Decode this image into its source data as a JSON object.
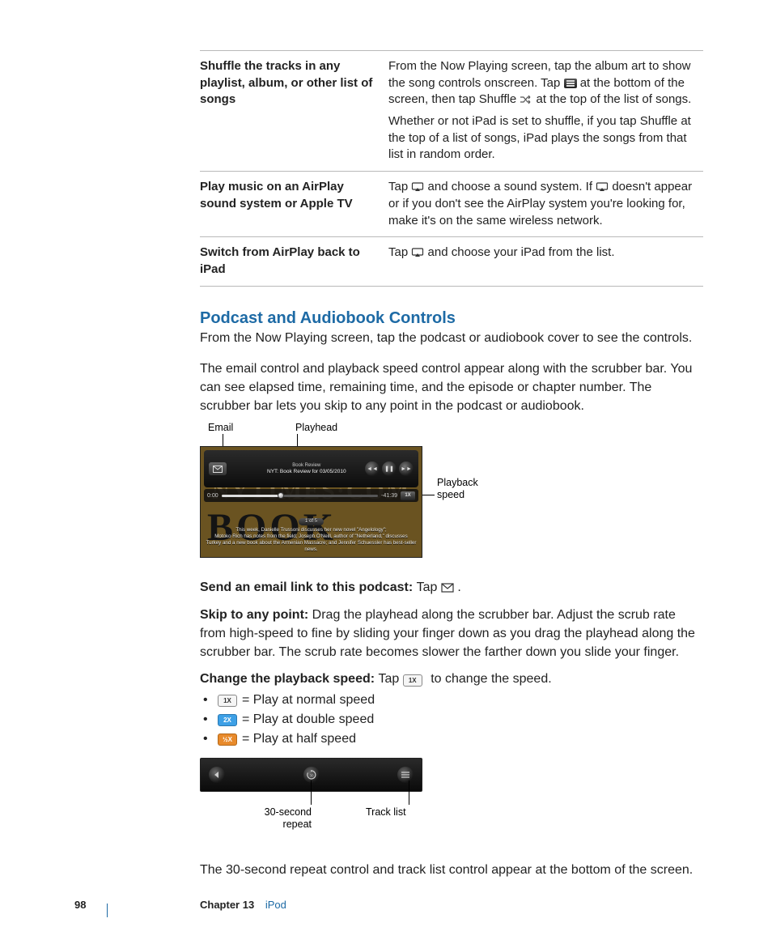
{
  "table": {
    "rows": [
      {
        "label": "Shuffle the tracks in any playlist, album, or other list of songs",
        "p1a": "From the Now Playing screen, tap the album art to show the song controls onscreen. Tap ",
        "p1b": " at the bottom of the screen, then tap Shuffle ",
        "p1c": " at the top of the list of songs.",
        "p2": "Whether or not iPad is set to shuffle, if you tap Shuffle at the top of a list of songs, iPad plays the songs from that list in random order."
      },
      {
        "label": "Play music on an AirPlay sound system or Apple TV",
        "p1a": "Tap ",
        "p1b": " and choose a sound system. If ",
        "p1c": " doesn't appear or if you don't see the AirPlay system you're looking for, make it's on the same wireless network."
      },
      {
        "label": "Switch from AirPlay back to iPad",
        "p1a": "Tap ",
        "p1b": " and choose your iPad from the list."
      }
    ]
  },
  "section_title": "Podcast and Audiobook Controls",
  "p_intro": "From the Now Playing screen, tap the podcast or audiobook cover to see the controls.",
  "p_desc": "The email control and playback speed control appear along with the scrubber bar. You can see elapsed time, remaining time, and the episode or chapter number. The scrubber bar lets you skip to any point in the podcast or audiobook.",
  "fig1": {
    "label_email": "Email",
    "label_playhead": "Playhead",
    "label_speed": "Playback\nspeed",
    "title1": "Book Review",
    "title2": "NYT: Book Review for 03/05/2010",
    "time_l": "0:00",
    "time_r": "-41:39",
    "speed": "1X",
    "pill": "1 of 5",
    "caption": "This week, Danielle Trussoni discusses her new novel \"Angelology\";\nMotoko Rich has notes from the field; Joseph O'Neill, author of \"Netherland,\" discusses\nTurkey and a new book about the Armenian Massacre; and Jennifer Schuessler has best-seller news.",
    "bgtext1": "NYTIMES·COM",
    "bgtext2": "BOOK"
  },
  "instr": {
    "email_lead": "Send an email link to this podcast:  ",
    "email_body": "Tap ",
    "email_tail": ".",
    "skip_lead": "Skip to any point:  ",
    "skip_body": "Drag the playhead along the scrubber bar. Adjust the scrub rate from high-speed to fine by sliding your finger down as you drag the playhead along the scrubber bar. The scrub rate becomes slower the farther down you slide your finger.",
    "speed_lead": "Change the playback speed:  ",
    "speed_body": "Tap ",
    "speed_tail": " to change the speed.",
    "li1_badge": "1X",
    "li1": " = Play at normal speed",
    "li2_badge": "2X",
    "li2": " = Play at double speed",
    "li3_badge": "½X",
    "li3": " = Play at half speed"
  },
  "fig2": {
    "label_repeat": "30-second\nrepeat",
    "label_tracklist": "Track list"
  },
  "p_bottom": "The 30-second repeat control and track list control appear at the bottom of the screen.",
  "footer": {
    "page": "98",
    "chapter_label": "Chapter 13",
    "chapter_name": "iPod"
  }
}
